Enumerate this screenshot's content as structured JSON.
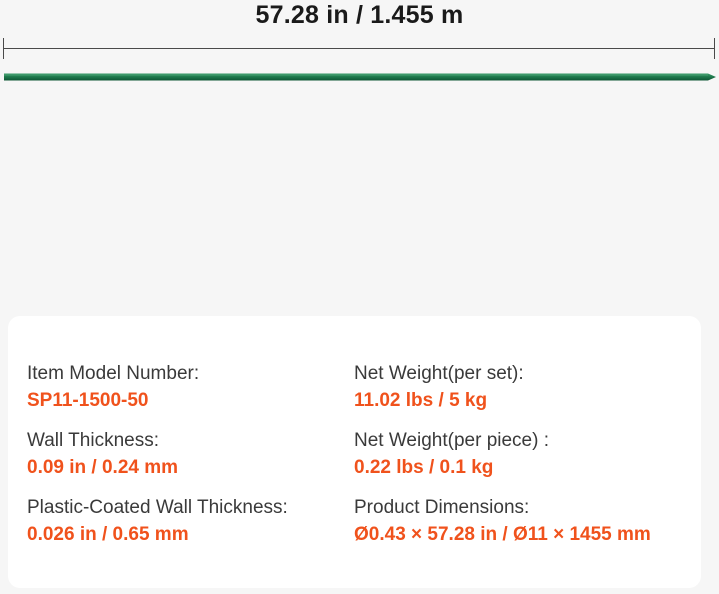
{
  "dimension": {
    "length_label": "57.28 in / 1.455 m"
  },
  "colors": {
    "accent": "#f0521c",
    "stake_green": "#1f7a4d",
    "card_background": "#ffffff",
    "page_background": "#f6f6f6"
  },
  "specs": {
    "model": {
      "label": "Item Model Number:",
      "value": "SP11-1500-50"
    },
    "net_weight_set": {
      "label": "Net Weight(per set):",
      "value": "11.02 lbs / 5 kg"
    },
    "wall_thickness": {
      "label": "Wall Thickness:",
      "value": "0.09 in / 0.24 mm"
    },
    "net_weight_piece": {
      "label": "Net Weight(per piece) :",
      "value": "0.22 lbs / 0.1 kg"
    },
    "coated_thickness": {
      "label": "Plastic-Coated Wall Thickness:",
      "value": "0.026 in / 0.65 mm"
    },
    "dimensions": {
      "label": "Product Dimensions:",
      "value": "Ø0.43 × 57.28 in / Ø11 × 1455 mm"
    }
  }
}
